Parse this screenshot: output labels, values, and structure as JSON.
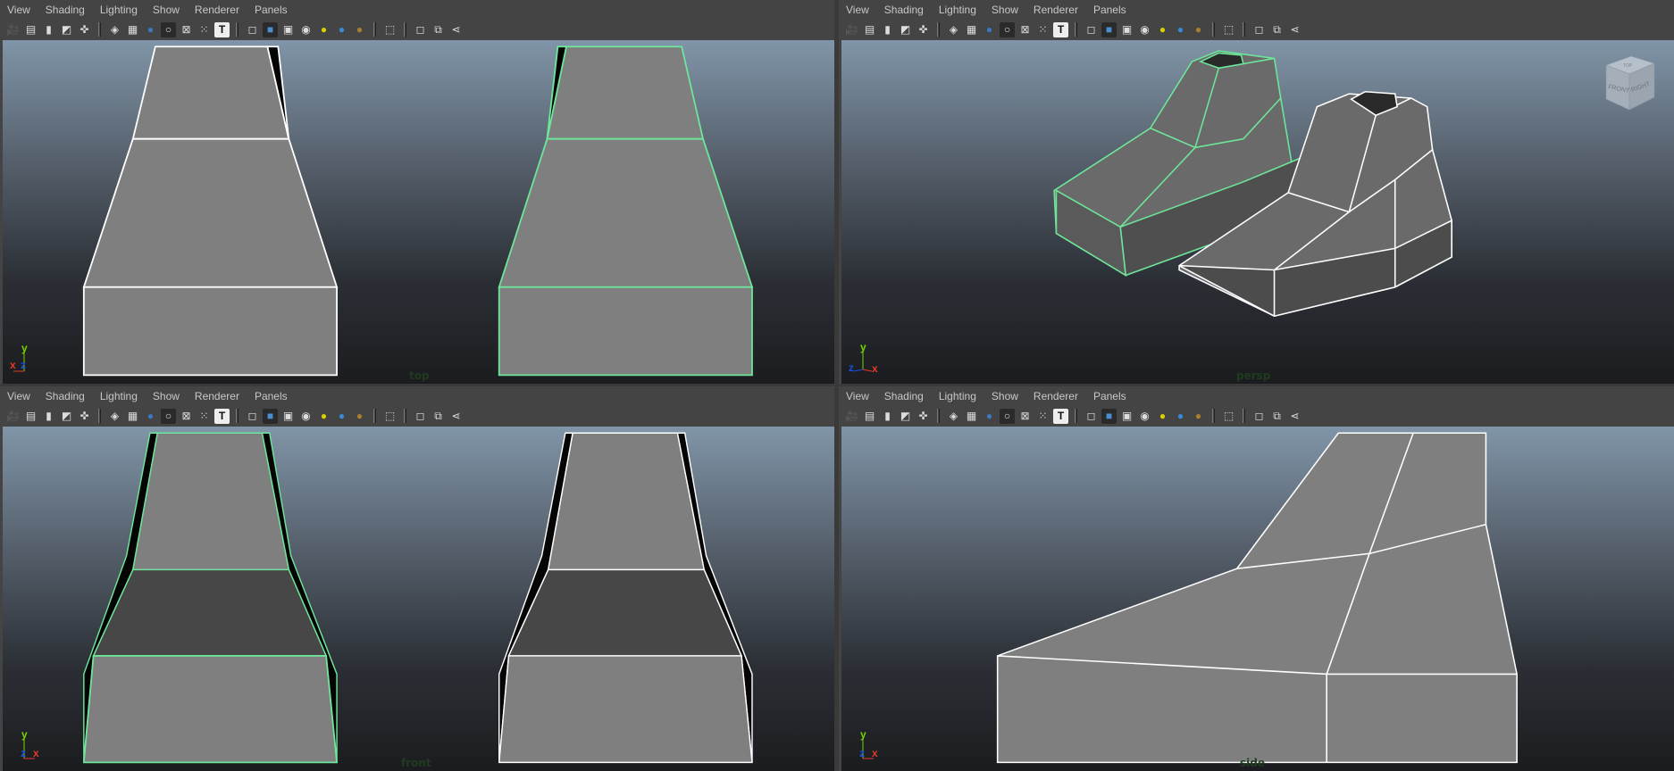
{
  "menu": [
    "View",
    "Shading",
    "Lighting",
    "Show",
    "Renderer",
    "Panels"
  ],
  "toolbar_icons": [
    {
      "name": "camera-select-icon",
      "glyph": "🎥"
    },
    {
      "name": "camera-attributes-icon",
      "glyph": "▤"
    },
    {
      "name": "bookmark-icon",
      "glyph": "▮"
    },
    {
      "name": "image-plane-icon",
      "glyph": "◩"
    },
    {
      "name": "2d-pan-zoom-icon",
      "glyph": "✜"
    },
    {
      "sep": true
    },
    {
      "name": "grid-icon",
      "glyph": "◈"
    },
    {
      "name": "film-gate-icon",
      "glyph": "▦"
    },
    {
      "name": "resolution-gate-icon",
      "glyph": "●"
    },
    {
      "name": "gate-mask-icon",
      "glyph": "○"
    },
    {
      "name": "field-chart-icon",
      "glyph": "⊠"
    },
    {
      "name": "safe-action-icon",
      "glyph": "⁙"
    },
    {
      "name": "safe-title-icon",
      "glyph": "T"
    },
    {
      "sep": true
    },
    {
      "name": "wireframe-icon",
      "glyph": "◻"
    },
    {
      "name": "smooth-shade-icon",
      "glyph": "■"
    },
    {
      "name": "wireframe-on-shaded-icon",
      "glyph": "▣"
    },
    {
      "name": "textured-icon",
      "glyph": "◉"
    },
    {
      "name": "use-all-lights-icon",
      "glyph": "●"
    },
    {
      "name": "shadows-icon",
      "glyph": "●"
    },
    {
      "name": "ambient-occlusion-icon",
      "glyph": "●"
    },
    {
      "sep": true
    },
    {
      "name": "select-camera-icon",
      "glyph": "⬚"
    },
    {
      "sep": true
    },
    {
      "name": "isolate-select-icon",
      "glyph": "◻"
    },
    {
      "name": "xray-icon",
      "glyph": "⧉"
    },
    {
      "name": "share-icon",
      "glyph": "⋖"
    }
  ],
  "viewports": {
    "top": {
      "label": "top",
      "axis": [
        "x",
        "z",
        "y"
      ]
    },
    "persp": {
      "label": "persp",
      "axis": [
        "z",
        "x",
        "y"
      ],
      "view_cube": [
        "FRONT",
        "RIGHT",
        "TOP"
      ]
    },
    "front": {
      "label": "front",
      "axis": [
        "z",
        "x",
        "y"
      ]
    },
    "side": {
      "label": "side",
      "axis": [
        "z",
        "x",
        "y"
      ]
    }
  },
  "colors": {
    "selected_wire": "#6ee69a",
    "wire": "#ffffff",
    "face": "#7f7f7f",
    "dark_face": "#4a4a4a",
    "axis_x": "#e53a2a",
    "axis_y": "#7ad400",
    "axis_z": "#1a4ee6"
  }
}
